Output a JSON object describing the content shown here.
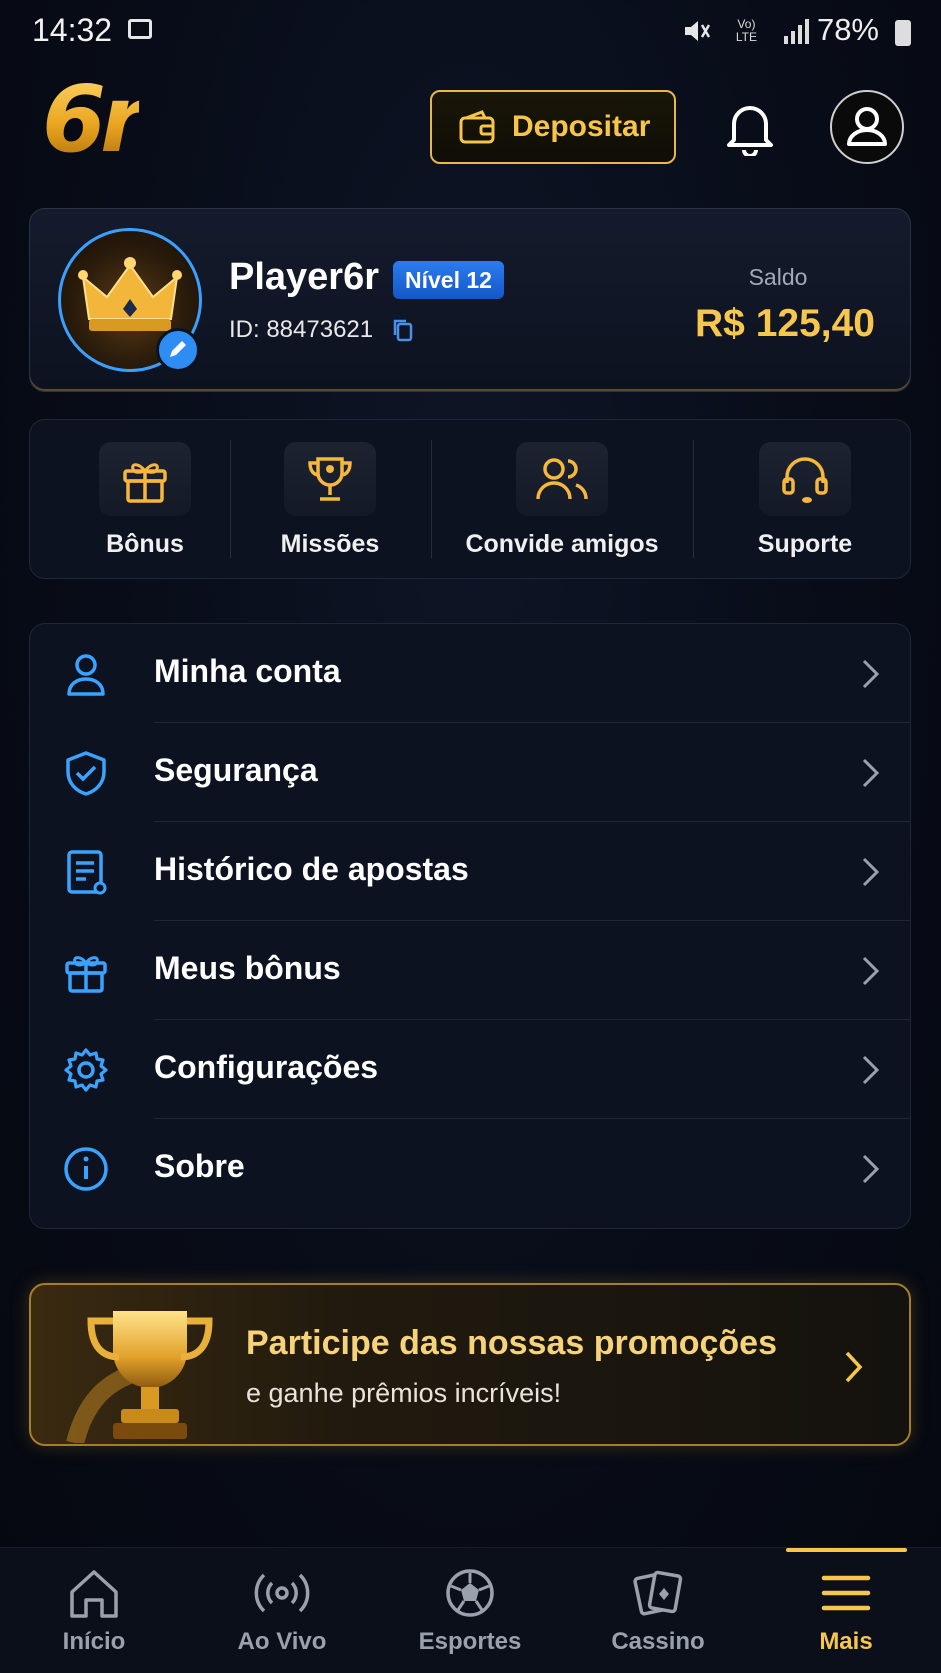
{
  "status_bar": {
    "time": "14:32",
    "network": "LTE",
    "volte": "Vo)",
    "battery": "78%"
  },
  "header": {
    "logo": "6r",
    "deposit_label": "Depositar"
  },
  "profile": {
    "name": "Player6r",
    "level": "Nível 12",
    "id": "ID: 88473621",
    "balance_label": "Saldo",
    "balance": "R$ 125,40"
  },
  "quick_actions": [
    {
      "label": "Bônus",
      "icon": "gift-icon"
    },
    {
      "label": "Missões",
      "icon": "trophy-icon"
    },
    {
      "label": "Convide amigos",
      "icon": "users-icon"
    },
    {
      "label": "Suporte",
      "icon": "headset-icon"
    }
  ],
  "menu": [
    {
      "label": "Minha conta",
      "icon": "user-icon"
    },
    {
      "label": "Segurança",
      "icon": "shield-icon"
    },
    {
      "label": "Histórico de apostas",
      "icon": "document-icon"
    },
    {
      "label": "Meus bônus",
      "icon": "gift-icon"
    },
    {
      "label": "Configurações",
      "icon": "gear-icon"
    },
    {
      "label": "Sobre",
      "icon": "info-icon"
    }
  ],
  "promo": {
    "title": "Participe das nossas promoções",
    "subtitle": "e ganhe prêmios incríveis!"
  },
  "bottom_nav": [
    {
      "label": "Início",
      "icon": "home-icon"
    },
    {
      "label": "Ao Vivo",
      "icon": "live-icon"
    },
    {
      "label": "Esportes",
      "icon": "soccer-ball-icon"
    },
    {
      "label": "Cassino",
      "icon": "cards-icon"
    },
    {
      "label": "Mais",
      "icon": "menu-icon",
      "active": true
    }
  ],
  "colors": {
    "gold": "#f6c74c",
    "blue": "#2e8df2",
    "bg": "#080c18"
  }
}
